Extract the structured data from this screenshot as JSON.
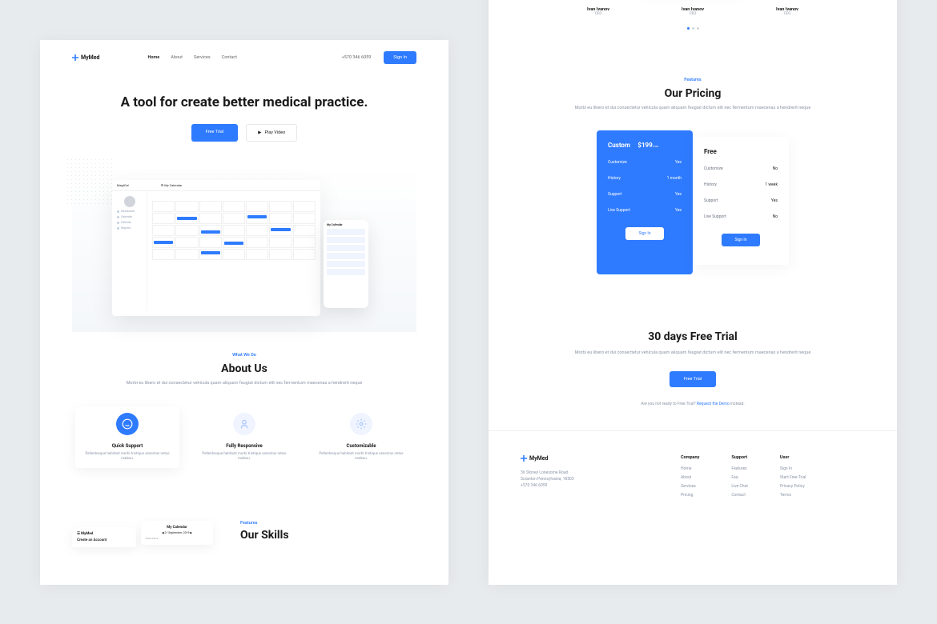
{
  "brand": "MyMed",
  "nav": {
    "items": [
      "Home",
      "About",
      "Services",
      "Contact"
    ],
    "phone": "+570 346 6059",
    "signin": "Sign In"
  },
  "hero": {
    "title": "A tool for create better medical practice.",
    "cta1": "Free Trial",
    "cta2": "Play Video"
  },
  "mockup": {
    "app": "MagiCal",
    "tab": "My Calendar",
    "sidebar": [
      "Dashboard",
      "Calendar",
      "Patients",
      "Reports"
    ],
    "phone_title": "My Calendar"
  },
  "about": {
    "eyebrow": "What We Do",
    "title": "About Us",
    "desc": "Morbi eu libero et dui consectetur vehicula quam aliquam feugiat dictum elit nec fermentum maecenas a hendrerit neque"
  },
  "cards": [
    {
      "title": "Quick Support",
      "desc": "Pellentesque habitant morbi tristique senectus netus malesu."
    },
    {
      "title": "Fully Responsive",
      "desc": "Pellentesque habitant morbi tristique senectus netus malesu."
    },
    {
      "title": "Customizable",
      "desc": "Pellentesque habitant morbi tristique senectus netus malesu."
    }
  ],
  "skills": {
    "eyebrow": "Features",
    "title": "Our Skills",
    "card1_title": "Create an Account",
    "card2_title": "My Calendar",
    "card2_date": "21 September, 2019"
  },
  "testimonials": {
    "items": [
      {
        "name": "Ivan Ivanov",
        "role": "CEO"
      },
      {
        "name": "Ivan Ivanov",
        "role": "CEO"
      },
      {
        "name": "Ivan Ivanov",
        "role": "CEO"
      }
    ]
  },
  "pricing": {
    "eyebrow": "Features",
    "title": "Our Pricing",
    "desc": "Morbi eu libero et dui consectetur vehicula quam aliquam feugiat dictum elit nec fermentum maecenas a hendrerit neque",
    "plans": [
      {
        "name": "Custom",
        "price": "$199",
        "unit": "/mo",
        "rows": [
          [
            "Customize",
            "Yes"
          ],
          [
            "History",
            "1 month"
          ],
          [
            "Support",
            "Yes"
          ],
          [
            "Live Support",
            "Yes"
          ]
        ],
        "btn": "Sign In"
      },
      {
        "name": "Free",
        "rows": [
          [
            "Customize",
            "No"
          ],
          [
            "History",
            "1 week"
          ],
          [
            "Support",
            "Yes"
          ],
          [
            "Live Support",
            "No"
          ]
        ],
        "btn": "Sign In"
      }
    ]
  },
  "trial": {
    "title": "30 days Free Trial",
    "desc": "Morbi eu libero et dui consectetur vehicula quam aliquam feugiat dictum elit nec fermentum maecenas a hendrerit neque",
    "btn": "Free Trial",
    "note_before": "Are you not ready to Free Trial? ",
    "note_link": "Request the Demo",
    "note_after": " instead."
  },
  "footer": {
    "addr": "36 Stoney Lonesome Road\nScranton Pennsylvania, 18503\n+570 346 6059",
    "cols": [
      {
        "h": "Company",
        "items": [
          "Home",
          "About",
          "Services",
          "Pricing"
        ]
      },
      {
        "h": "Support",
        "items": [
          "Features",
          "Faq",
          "Live Chat",
          "Contact"
        ]
      },
      {
        "h": "User",
        "items": [
          "Sign In",
          "Start Free Trial",
          "Privacy Policy",
          "Terms"
        ]
      }
    ]
  }
}
